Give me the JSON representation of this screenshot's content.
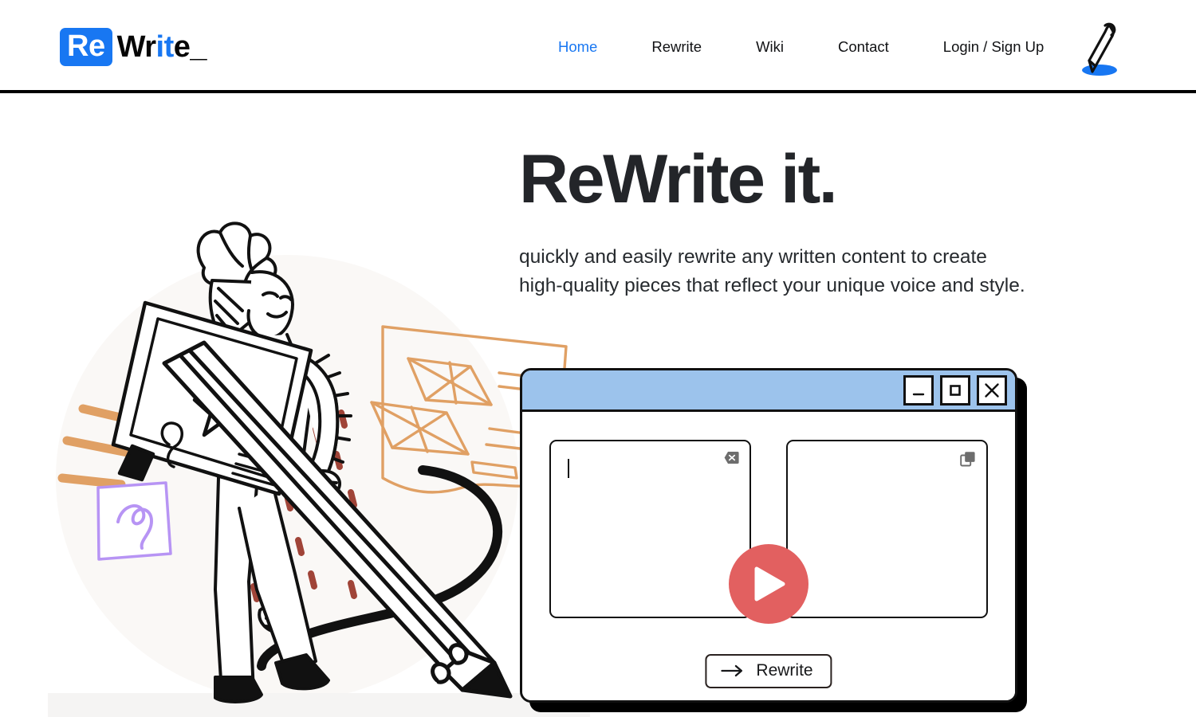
{
  "header": {
    "logo": {
      "badge_text": "Re",
      "part_dark_1": "Wr",
      "part_blue": "it",
      "part_dark_2": "e_",
      "badge_bg": "#1877F2",
      "accent": "#1877F2"
    },
    "nav": [
      {
        "label": "Home",
        "active": true,
        "name": "nav-home"
      },
      {
        "label": "Rewrite",
        "active": false,
        "name": "nav-rewrite"
      },
      {
        "label": "Wiki",
        "active": false,
        "name": "nav-wiki"
      },
      {
        "label": "Contact",
        "active": false,
        "name": "nav-contact"
      },
      {
        "label": "Login / Sign Up",
        "active": false,
        "name": "nav-login-signup"
      }
    ],
    "pen_icon": "pen-icon"
  },
  "hero": {
    "title": "ReWrite it.",
    "subtitle": "quickly and easily rewrite any written content to create high-quality pieces that reflect your unique voice and style.",
    "title_color": "#232529"
  },
  "illustration": {
    "name": "woman-with-pencil-illustration",
    "accent_orange": "#e0a064",
    "accent_purple": "#b794f4",
    "accent_red": "#a04438"
  },
  "app_window": {
    "titlebar_color": "#9cc3ec",
    "controls": [
      {
        "name": "minimize-button",
        "glyph": "minimize"
      },
      {
        "name": "maximize-button",
        "glyph": "maximize"
      },
      {
        "name": "close-button",
        "glyph": "close"
      }
    ],
    "input_panel": {
      "name": "input-textarea",
      "value": "",
      "placeholder": "",
      "clear_icon": "clear-x-icon"
    },
    "output_panel": {
      "name": "output-textarea",
      "value": "",
      "placeholder": "",
      "copy_icon": "copy-icon"
    },
    "play_button": {
      "name": "play-video-button",
      "color": "#e26060"
    },
    "rewrite_button": {
      "label": "Rewrite",
      "icon": "arrow-right-icon"
    }
  }
}
